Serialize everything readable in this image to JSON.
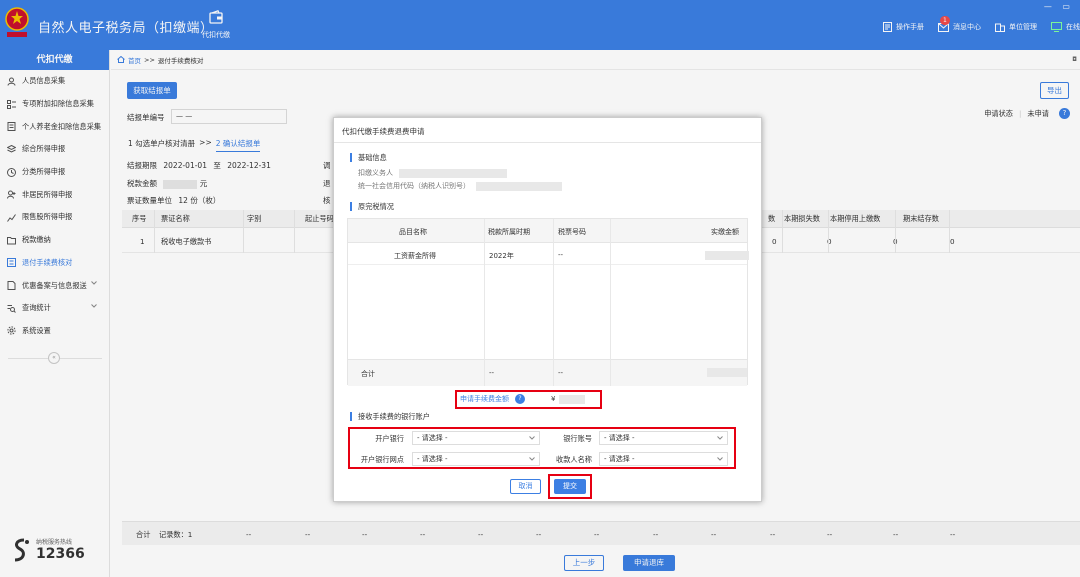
{
  "app": {
    "title": "自然人电子税务局（扣缴端）",
    "top_tab": "代扣代缴",
    "window_controls": "— ▭"
  },
  "topbar": {
    "links": [
      {
        "label": "操作手册"
      },
      {
        "label": "消息中心",
        "badge": "1"
      },
      {
        "label": "单位管理"
      },
      {
        "label": "在线"
      }
    ]
  },
  "sidebar": {
    "header": "代扣代缴",
    "items": [
      {
        "label": "人员信息采集"
      },
      {
        "label": "专项附加扣除信息采集"
      },
      {
        "label": "个人养老金扣除信息采集"
      },
      {
        "label": "综合所得申报"
      },
      {
        "label": "分类所得申报"
      },
      {
        "label": "非居民所得申报"
      },
      {
        "label": "限售股所得申报"
      },
      {
        "label": "税款缴纳"
      },
      {
        "label": "退付手续费核对"
      },
      {
        "label": "优惠备案与信息报送"
      },
      {
        "label": "查询统计"
      },
      {
        "label": "系统设置"
      }
    ],
    "collapse_glyph": "«",
    "hotline_label": "纳税服务热线",
    "hotline_number": "12366"
  },
  "breadcrumb": {
    "home": "首页",
    "separator": ">>",
    "current": "退付手续费核对",
    "tail": "◘"
  },
  "main": {
    "get_report_button": "获取结报单",
    "export_button": "导出",
    "report_no_label": "结报单编号",
    "report_no_value": "— —",
    "status_label": "申请状态",
    "status_value": "未申请",
    "help_glyph": "?",
    "steps": {
      "step1": "1 勾选单户核对清册",
      "arrow": ">>",
      "step2": "2 确认结报单"
    },
    "period_label": "结报期限",
    "period_start": "2022-01-01",
    "period_to": "至",
    "period_end": "2022-12-31",
    "tax_amount_label": "税款金额",
    "tax_amount_unit": "元",
    "ticket_label": "票证数量单位",
    "ticket_value": "12 份（枚）",
    "hidden_label_1": "调",
    "hidden_label_2": "退",
    "hidden_label_3": "核",
    "table": {
      "headers": [
        "序号",
        "票证名称",
        "字别",
        "起止号码",
        "数",
        "本期损失数",
        "本期停用上缴数",
        "期末结存数"
      ],
      "rows": [
        {
          "index": "1",
          "name": "税收电子缴款书",
          "count": "0",
          "loss": "0",
          "stop": "0",
          "end": "0"
        }
      ],
      "footer_total": "合计",
      "footer_records": "记录数：1",
      "footer_dash": "--"
    },
    "prev_button": "上一步",
    "refund_button": "申请退库"
  },
  "modal": {
    "title": "代扣代缴手续费退费申请",
    "basic_section": "基础信息",
    "withholding_agent_label": "扣缴义务人",
    "credit_code_label": "统一社会信用代码（纳税人识别号）",
    "original_section": "原完税情况",
    "inner_headers": [
      "品目名称",
      "税款所属时期",
      "税票号码",
      "实缴金额"
    ],
    "inner_row": {
      "item": "工资薪金所得",
      "period": "2022年",
      "ticket": "--"
    },
    "sum_label": "合计",
    "sum_dash": "--",
    "fee_label": "申请手续费金额",
    "fee_help": "?",
    "fee_currency": "¥",
    "bank_section": "接收手续费的银行账户",
    "bank_fields": {
      "bank_label": "开户银行",
      "account_label": "银行账号",
      "branch_label": "开户银行网点",
      "payee_label": "收款人名称",
      "placeholder": "- 请选择 -"
    },
    "cancel_button": "取消",
    "submit_button": "提交"
  },
  "colors": {
    "primary": "#3c7fe3",
    "highlight_red": "#e60012",
    "badge_red": "#f04a4a"
  }
}
